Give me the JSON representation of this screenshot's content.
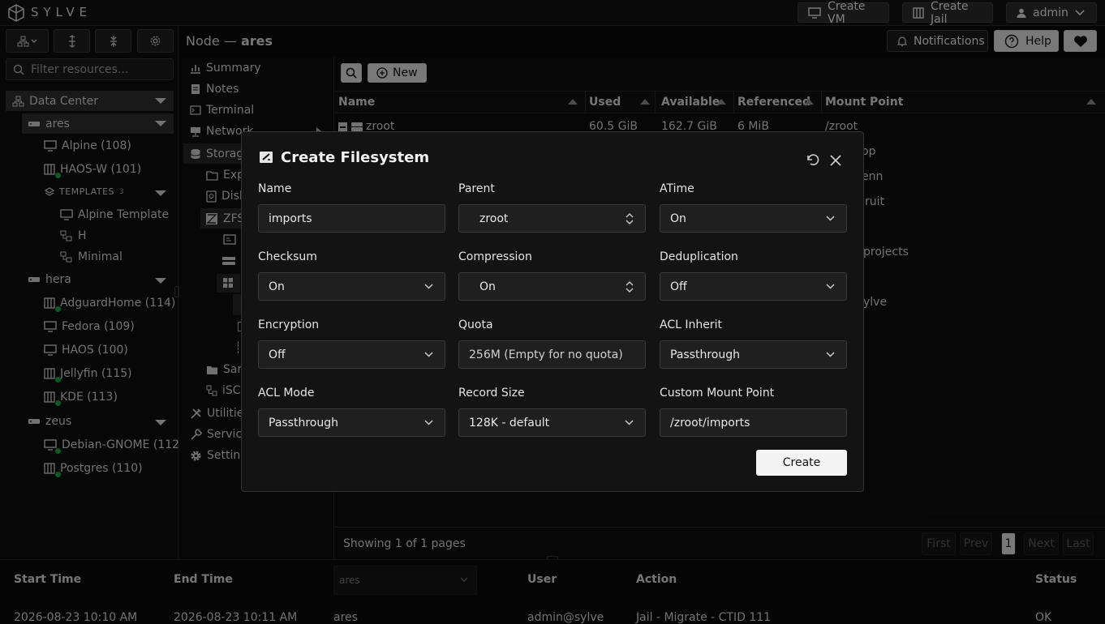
{
  "app": {
    "brand": "SYLVE"
  },
  "topbar": {
    "create_vm": "Create VM",
    "create_jail": "Create Jail",
    "user": "admin"
  },
  "header": {
    "node_prefix": "Node —",
    "node_name": "ares",
    "notifications": "Notifications",
    "help": "Help"
  },
  "sidebar": {
    "search_placeholder": "Filter resources...",
    "datacenter": "Data Center",
    "nodes": [
      {
        "name": "ares",
        "items": [
          "Alpine (108)",
          "HAOS-W (101)"
        ],
        "templates_label": "TEMPLATES",
        "templates_count": "3",
        "templates": [
          "Alpine Template",
          "H",
          "Minimal"
        ]
      },
      {
        "name": "hera",
        "items": [
          "AdguardHome (114)",
          "Fedora (109)",
          "HAOS (100)",
          "Jellyfin (115)",
          "KDE (113)"
        ]
      },
      {
        "name": "zeus",
        "items": [
          "Debian-GNOME (112)",
          "Postgres (110)"
        ]
      }
    ]
  },
  "nav": {
    "items": [
      "Summary",
      "Notes",
      "Terminal",
      "Network",
      "Storage",
      "Exp",
      "Disk",
      "ZFS",
      "Sam",
      "iSCS",
      "Utilities",
      "Services",
      "Settings"
    ]
  },
  "toolbar": {
    "new_label": "New"
  },
  "table": {
    "columns": [
      "Name",
      "Used",
      "Available",
      "Referenced",
      "Mount Point"
    ],
    "first_row": {
      "name": "zroot",
      "used": "60.5 GiB",
      "available": "162.7 GiB",
      "referenced": "6 MiB",
      "mount": "/zroot"
    },
    "partial_mounts": [
      "op",
      "enn",
      "ruit",
      "projects",
      "ylve"
    ]
  },
  "pagination": {
    "summary": "Showing 1 of 1 pages",
    "first": "First",
    "prev": "Prev",
    "page": "1",
    "next": "Next",
    "last": "Last"
  },
  "bottom": {
    "headers": {
      "start": "Start Time",
      "end": "End Time",
      "node_filter": "ares",
      "user": "User",
      "action": "Action",
      "status": "Status"
    },
    "row": {
      "start": "2026-08-23 10:10 AM",
      "end": "2026-08-23 10:11 AM",
      "node": "ares",
      "user": "admin@sylve",
      "action": "Jail - Migrate - CTID 111",
      "status": "OK"
    }
  },
  "modal": {
    "title": "Create Filesystem",
    "fields": {
      "name": {
        "label": "Name",
        "value": "imports"
      },
      "parent": {
        "label": "Parent",
        "value": "zroot"
      },
      "atime": {
        "label": "ATime",
        "value": "On"
      },
      "checksum": {
        "label": "Checksum",
        "value": "On"
      },
      "compression": {
        "label": "Compression",
        "value": "On"
      },
      "dedup": {
        "label": "Deduplication",
        "value": "Off"
      },
      "encryption": {
        "label": "Encryption",
        "value": "Off"
      },
      "quota": {
        "label": "Quota",
        "placeholder": "256M (Empty for no quota)"
      },
      "acl_inherit": {
        "label": "ACL Inherit",
        "value": "Passthrough"
      },
      "acl_mode": {
        "label": "ACL Mode",
        "value": "Passthrough"
      },
      "record_size": {
        "label": "Record Size",
        "value": "128K - default"
      },
      "mount_point": {
        "label": "Custom Mount Point",
        "value": "/zroot/imports"
      }
    },
    "create_label": "Create"
  }
}
